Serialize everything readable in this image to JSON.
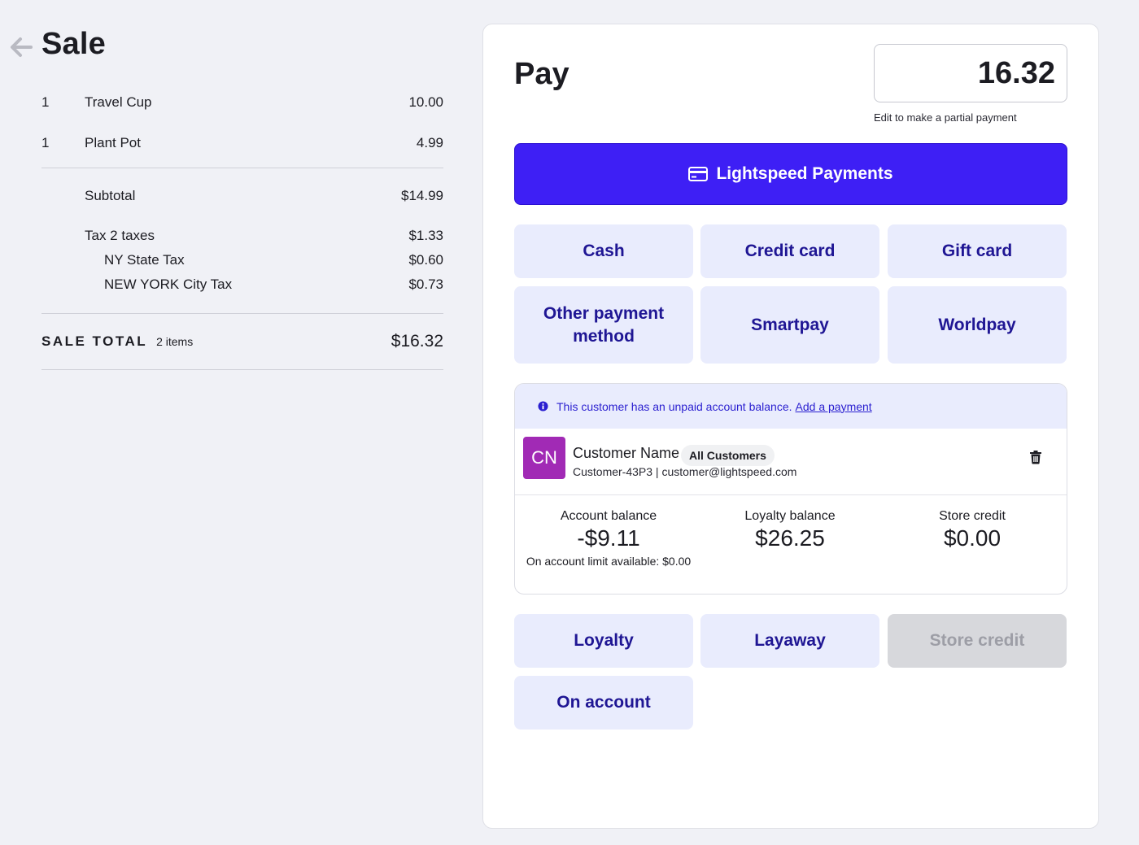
{
  "sale": {
    "title": "Sale",
    "lines": [
      {
        "qty": "1",
        "name": "Travel Cup",
        "price": "10.00"
      },
      {
        "qty": "1",
        "name": "Plant Pot",
        "price": "4.99"
      }
    ],
    "subtotal_label": "Subtotal",
    "subtotal_value": "$14.99",
    "tax_label": "Tax 2 taxes",
    "tax_value": "$1.33",
    "taxes": [
      {
        "name": "NY State Tax",
        "value": "$0.60"
      },
      {
        "name": "NEW YORK City Tax",
        "value": "$0.73"
      }
    ],
    "total_label": "SALE TOTAL",
    "total_items": "2 items",
    "total_value": "$16.32"
  },
  "pay": {
    "title": "Pay",
    "amount": "16.32",
    "amount_hint": "Edit to make a partial payment",
    "lightspeed_label": "Lightspeed Payments",
    "methods": {
      "cash": "Cash",
      "credit_card": "Credit card",
      "gift_card": "Gift card",
      "other": "Other payment method",
      "smartpay": "Smartpay",
      "worldpay": "Worldpay"
    },
    "account_methods": {
      "loyalty": "Loyalty",
      "layaway": "Layaway",
      "store_credit": "Store credit",
      "on_account": "On account"
    }
  },
  "customer": {
    "alert_text": "This customer has an unpaid account balance.",
    "alert_link": "Add a payment",
    "initials": "CN",
    "name": "Customer Name",
    "group": "All Customers",
    "details": "Customer-43P3 | customer@lightspeed.com",
    "account_balance_label": "Account balance",
    "account_balance_value": "-$9.11",
    "account_limit_note": "On account limit available: $0.00",
    "loyalty_balance_label": "Loyalty balance",
    "loyalty_balance_value": "$26.25",
    "store_credit_label": "Store credit",
    "store_credit_value": "$0.00"
  },
  "colors": {
    "primary": "#3e1ff5",
    "button_bg": "#e9ecfd",
    "button_text": "#1f1694",
    "avatar": "#a12ab5",
    "disabled_bg": "#d7d8dc"
  },
  "icons": {
    "back": "arrow-left-icon",
    "card": "credit-card-icon",
    "info": "info-icon",
    "delete": "trash-icon"
  }
}
